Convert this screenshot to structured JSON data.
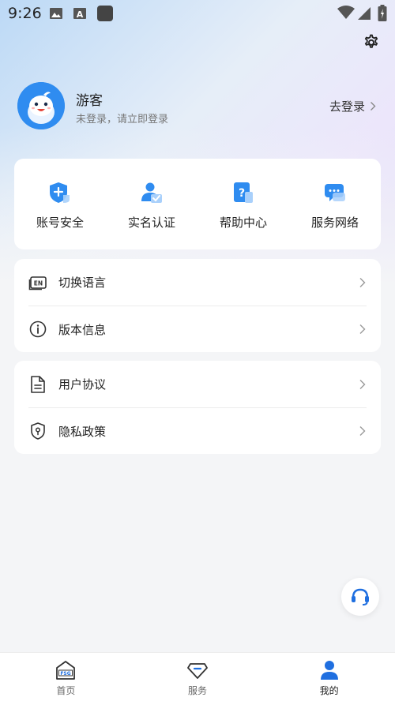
{
  "status_bar": {
    "time": "9:26"
  },
  "profile": {
    "nickname": "游客",
    "login_tip": "未登录，请立即登录",
    "login_link": "去登录"
  },
  "quick_actions": [
    {
      "label": "账号安全",
      "icon": "shield-plus-icon"
    },
    {
      "label": "实名认证",
      "icon": "user-verify-icon"
    },
    {
      "label": "帮助中心",
      "icon": "help-doc-icon"
    },
    {
      "label": "服务网络",
      "icon": "chat-bubble-icon"
    }
  ],
  "settings_group_1": [
    {
      "label": "切换语言",
      "icon": "language-en-icon"
    },
    {
      "label": "版本信息",
      "icon": "info-icon"
    }
  ],
  "settings_group_2": [
    {
      "label": "用户协议",
      "icon": "document-icon"
    },
    {
      "label": "隐私政策",
      "icon": "privacy-shield-icon"
    }
  ],
  "tabbar": {
    "home": "首页",
    "service": "服务",
    "mine": "我的",
    "active": "mine"
  },
  "colors": {
    "accent": "#2f8cf0",
    "text": "#222222",
    "subtext": "#777777"
  }
}
